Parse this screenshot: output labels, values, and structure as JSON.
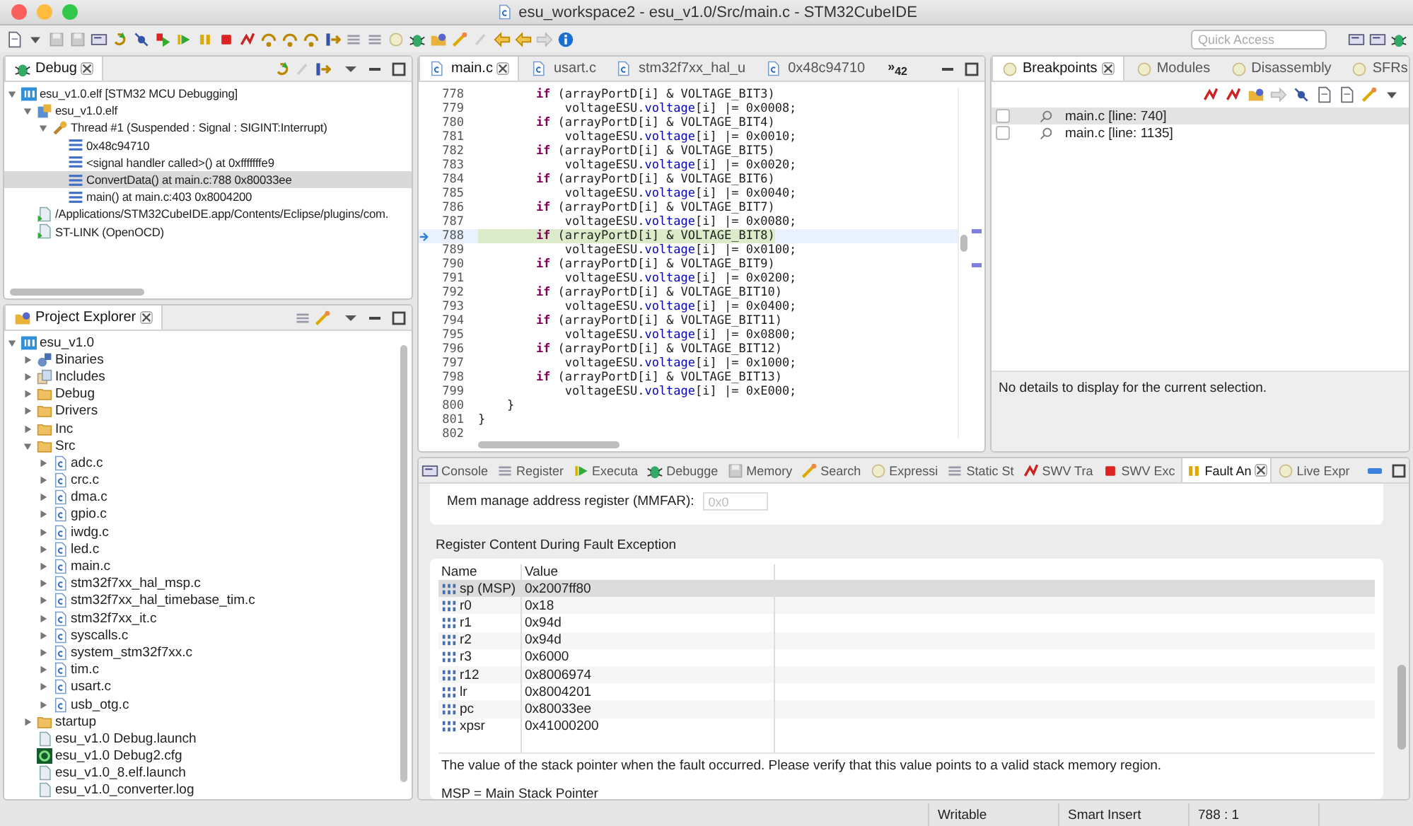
{
  "window": {
    "title": "esu_workspace2 - esu_v1.0/Src/main.c - STM32CubeIDE"
  },
  "toolbar": {
    "quick_access": {
      "placeholder": "Quick Access"
    }
  },
  "debug": {
    "tab": {
      "label": "Debug",
      "selected": true
    },
    "tree": [
      {
        "label": "esu_v1.0.elf [STM32 MCU Debugging]",
        "kind": "launch",
        "expanded": true,
        "selected": false,
        "children": [
          {
            "label": "esu_v1.0.elf",
            "kind": "process",
            "expanded": true,
            "selected": false,
            "children": [
              {
                "label": "Thread #1 (Suspended : Signal : SIGINT:Interrupt)",
                "kind": "thread",
                "expanded": true,
                "selected": false,
                "children": [
                  {
                    "label": "0x48c94710",
                    "kind": "frame",
                    "selected": false
                  },
                  {
                    "label": "<signal handler called>() at 0xfffffffe9",
                    "kind": "frame",
                    "selected": false
                  },
                  {
                    "label": "ConvertData() at main.c:788 0x80033ee",
                    "kind": "frame",
                    "selected": true
                  },
                  {
                    "label": "main() at main.c:403 0x8004200",
                    "kind": "frame",
                    "selected": false
                  }
                ]
              }
            ]
          },
          {
            "label": "/Applications/STM32CubeIDE.app/Contents/Eclipse/plugins/com.",
            "kind": "tool",
            "selected": false
          },
          {
            "label": "ST-LINK (OpenOCD)",
            "kind": "tool",
            "selected": false
          }
        ]
      }
    ]
  },
  "project_explorer": {
    "tab": {
      "label": "Project Explorer",
      "selected": true
    },
    "tree": [
      {
        "label": "esu_v1.0",
        "kind": "project",
        "expanded": true,
        "children": [
          {
            "label": "Binaries",
            "kind": "binaries",
            "expanded": false
          },
          {
            "label": "Includes",
            "kind": "includes",
            "expanded": false
          },
          {
            "label": "Debug",
            "kind": "folder",
            "expanded": false
          },
          {
            "label": "Drivers",
            "kind": "folder",
            "expanded": false
          },
          {
            "label": "Inc",
            "kind": "folder",
            "expanded": false
          },
          {
            "label": "Src",
            "kind": "folder",
            "expanded": true,
            "children": [
              {
                "label": "adc.c",
                "kind": "c-file",
                "expanded": false
              },
              {
                "label": "crc.c",
                "kind": "c-file",
                "expanded": false
              },
              {
                "label": "dma.c",
                "kind": "c-file",
                "expanded": false
              },
              {
                "label": "gpio.c",
                "kind": "c-file",
                "expanded": false
              },
              {
                "label": "iwdg.c",
                "kind": "c-file",
                "expanded": false
              },
              {
                "label": "led.c",
                "kind": "c-file",
                "expanded": false
              },
              {
                "label": "main.c",
                "kind": "c-file",
                "expanded": false
              },
              {
                "label": "stm32f7xx_hal_msp.c",
                "kind": "c-file",
                "expanded": false
              },
              {
                "label": "stm32f7xx_hal_timebase_tim.c",
                "kind": "c-file",
                "expanded": false
              },
              {
                "label": "stm32f7xx_it.c",
                "kind": "c-file",
                "expanded": false
              },
              {
                "label": "syscalls.c",
                "kind": "c-file",
                "expanded": false
              },
              {
                "label": "system_stm32f7xx.c",
                "kind": "c-file",
                "expanded": false
              },
              {
                "label": "tim.c",
                "kind": "c-file",
                "expanded": false
              },
              {
                "label": "usart.c",
                "kind": "c-file",
                "expanded": false
              },
              {
                "label": "usb_otg.c",
                "kind": "c-file",
                "expanded": false
              }
            ]
          },
          {
            "label": "startup",
            "kind": "folder",
            "expanded": false
          },
          {
            "label": "esu_v1.0 Debug.launch",
            "kind": "launch-file"
          },
          {
            "label": "esu_v1.0 Debug2.cfg",
            "kind": "cfg-file"
          },
          {
            "label": "esu_v1.0_8.elf.launch",
            "kind": "launch-file"
          },
          {
            "label": "esu_v1.0_converter.log",
            "kind": "launch-file"
          }
        ]
      }
    ]
  },
  "editor": {
    "tabs": [
      {
        "label": "main.c",
        "selected": true
      },
      {
        "label": "usart.c",
        "selected": false
      },
      {
        "label": "stm32f7xx_hal_u",
        "selected": false
      },
      {
        "label": "0x48c94710",
        "selected": false
      }
    ],
    "overflow": {
      "label": "»",
      "count": "42"
    },
    "lines": [
      {
        "number": "778",
        "current": false,
        "tokens": [
          {
            "kind": "keyword",
            "text": "        if"
          },
          {
            "kind": "plain",
            "text": " (arrayPortD[i] & VOLTAGE_BIT3)"
          }
        ]
      },
      {
        "number": "779",
        "current": false,
        "tokens": [
          {
            "kind": "plain",
            "text": "            voltageESU."
          },
          {
            "kind": "field",
            "text": "voltage"
          },
          {
            "kind": "plain",
            "text": "[i] |= 0x0008;"
          }
        ]
      },
      {
        "number": "780",
        "current": false,
        "tokens": [
          {
            "kind": "keyword",
            "text": "        if"
          },
          {
            "kind": "plain",
            "text": " (arrayPortD[i] & VOLTAGE_BIT4)"
          }
        ]
      },
      {
        "number": "781",
        "current": false,
        "tokens": [
          {
            "kind": "plain",
            "text": "            voltageESU."
          },
          {
            "kind": "field",
            "text": "voltage"
          },
          {
            "kind": "plain",
            "text": "[i] |= 0x0010;"
          }
        ]
      },
      {
        "number": "782",
        "current": false,
        "tokens": [
          {
            "kind": "keyword",
            "text": "        if"
          },
          {
            "kind": "plain",
            "text": " (arrayPortD[i] & VOLTAGE_BIT5)"
          }
        ]
      },
      {
        "number": "783",
        "current": false,
        "tokens": [
          {
            "kind": "plain",
            "text": "            voltageESU."
          },
          {
            "kind": "field",
            "text": "voltage"
          },
          {
            "kind": "plain",
            "text": "[i] |= 0x0020;"
          }
        ]
      },
      {
        "number": "784",
        "current": false,
        "tokens": [
          {
            "kind": "keyword",
            "text": "        if"
          },
          {
            "kind": "plain",
            "text": " (arrayPortD[i] & VOLTAGE_BIT6)"
          }
        ]
      },
      {
        "number": "785",
        "current": false,
        "tokens": [
          {
            "kind": "plain",
            "text": "            voltageESU."
          },
          {
            "kind": "field",
            "text": "voltage"
          },
          {
            "kind": "plain",
            "text": "[i] |= 0x0040;"
          }
        ]
      },
      {
        "number": "786",
        "current": false,
        "tokens": [
          {
            "kind": "keyword",
            "text": "        if"
          },
          {
            "kind": "plain",
            "text": " (arrayPortD[i] & VOLTAGE_BIT7)"
          }
        ]
      },
      {
        "number": "787",
        "current": false,
        "tokens": [
          {
            "kind": "plain",
            "text": "            voltageESU."
          },
          {
            "kind": "field",
            "text": "voltage"
          },
          {
            "kind": "plain",
            "text": "[i] |= 0x0080;"
          }
        ]
      },
      {
        "number": "788",
        "current": true,
        "tokens": [
          {
            "kind": "keyword",
            "text": "        if"
          },
          {
            "kind": "plain",
            "text": " (arrayPortD[i] & VOLTAGE_BIT8)"
          }
        ]
      },
      {
        "number": "789",
        "current": false,
        "tokens": [
          {
            "kind": "plain",
            "text": "            voltageESU."
          },
          {
            "kind": "field",
            "text": "voltage"
          },
          {
            "kind": "plain",
            "text": "[i] |= 0x0100;"
          }
        ]
      },
      {
        "number": "790",
        "current": false,
        "tokens": [
          {
            "kind": "keyword",
            "text": "        if"
          },
          {
            "kind": "plain",
            "text": " (arrayPortD[i] & VOLTAGE_BIT9)"
          }
        ]
      },
      {
        "number": "791",
        "current": false,
        "tokens": [
          {
            "kind": "plain",
            "text": "            voltageESU."
          },
          {
            "kind": "field",
            "text": "voltage"
          },
          {
            "kind": "plain",
            "text": "[i] |= 0x0200;"
          }
        ]
      },
      {
        "number": "792",
        "current": false,
        "tokens": [
          {
            "kind": "keyword",
            "text": "        if"
          },
          {
            "kind": "plain",
            "text": " (arrayPortD[i] & VOLTAGE_BIT10)"
          }
        ]
      },
      {
        "number": "793",
        "current": false,
        "tokens": [
          {
            "kind": "plain",
            "text": "            voltageESU."
          },
          {
            "kind": "field",
            "text": "voltage"
          },
          {
            "kind": "plain",
            "text": "[i] |= 0x0400;"
          }
        ]
      },
      {
        "number": "794",
        "current": false,
        "tokens": [
          {
            "kind": "keyword",
            "text": "        if"
          },
          {
            "kind": "plain",
            "text": " (arrayPortD[i] & VOLTAGE_BIT11)"
          }
        ]
      },
      {
        "number": "795",
        "current": false,
        "tokens": [
          {
            "kind": "plain",
            "text": "            voltageESU."
          },
          {
            "kind": "field",
            "text": "voltage"
          },
          {
            "kind": "plain",
            "text": "[i] |= 0x0800;"
          }
        ]
      },
      {
        "number": "796",
        "current": false,
        "tokens": [
          {
            "kind": "keyword",
            "text": "        if"
          },
          {
            "kind": "plain",
            "text": " (arrayPortD[i] & VOLTAGE_BIT12)"
          }
        ]
      },
      {
        "number": "797",
        "current": false,
        "tokens": [
          {
            "kind": "plain",
            "text": "            voltageESU."
          },
          {
            "kind": "field",
            "text": "voltage"
          },
          {
            "kind": "plain",
            "text": "[i] |= 0x1000;"
          }
        ]
      },
      {
        "number": "798",
        "current": false,
        "tokens": [
          {
            "kind": "keyword",
            "text": "        if"
          },
          {
            "kind": "plain",
            "text": " (arrayPortD[i] & VOLTAGE_BIT13)"
          }
        ]
      },
      {
        "number": "799",
        "current": false,
        "tokens": [
          {
            "kind": "plain",
            "text": "            voltageESU."
          },
          {
            "kind": "field",
            "text": "voltage"
          },
          {
            "kind": "plain",
            "text": "[i] |= 0xE000;"
          }
        ]
      },
      {
        "number": "800",
        "current": false,
        "tokens": [
          {
            "kind": "plain",
            "text": "    }"
          }
        ]
      },
      {
        "number": "801",
        "current": false,
        "tokens": [
          {
            "kind": "plain",
            "text": "}"
          }
        ]
      },
      {
        "number": "802",
        "current": false
      }
    ]
  },
  "breakpoints": {
    "tabs": [
      {
        "label": "Breakpoints",
        "selected": true
      },
      {
        "label": "Modules",
        "selected": false
      },
      {
        "label": "Disassembly",
        "selected": false
      },
      {
        "label": "SFRs",
        "selected": false
      }
    ],
    "items": [
      {
        "label": "main.c [line: 740]",
        "checked": false,
        "selected": true
      },
      {
        "label": "main.c [line: 1135]",
        "checked": false,
        "selected": false
      }
    ],
    "details": "No details to display for the current selection."
  },
  "bottom_panel": {
    "tabs": [
      {
        "label": "Console",
        "selected": false
      },
      {
        "label": "Register",
        "selected": false
      },
      {
        "label": "Executa",
        "selected": false
      },
      {
        "label": "Debugge",
        "selected": false
      },
      {
        "label": "Memory",
        "selected": false
      },
      {
        "label": "Search",
        "selected": false
      },
      {
        "label": "Expressi",
        "selected": false
      },
      {
        "label": "Static St",
        "selected": false
      },
      {
        "label": "SWV Tra",
        "selected": false
      },
      {
        "label": "SWV Exc",
        "selected": false
      },
      {
        "label": "Fault An",
        "selected": true
      },
      {
        "label": "Live Expr",
        "selected": false
      }
    ],
    "mmfar": {
      "label": "Mem manage address register (MMFAR):",
      "value": "0x0",
      "disabled": true
    },
    "section_title": "Register Content During Fault Exception",
    "table": {
      "columns": [
        "Name",
        "Value"
      ],
      "rows": [
        {
          "name": "sp (MSP)",
          "value": "0x2007ff80",
          "selected": true
        },
        {
          "name": "r0",
          "value": "0x18",
          "selected": false
        },
        {
          "name": "r1",
          "value": "0x94d",
          "selected": false
        },
        {
          "name": "r2",
          "value": "0x94d",
          "selected": false
        },
        {
          "name": "r3",
          "value": "0x6000",
          "selected": false
        },
        {
          "name": "r12",
          "value": "0x8006974",
          "selected": false
        },
        {
          "name": "lr",
          "value": "0x8004201",
          "selected": false
        },
        {
          "name": "pc",
          "value": "0x80033ee",
          "selected": false
        },
        {
          "name": "xpsr",
          "value": "0x41000200",
          "selected": false
        }
      ]
    },
    "description": [
      "The value of the stack pointer when the fault occurred. Please verify that this value points to a valid stack memory region.",
      "MSP = Main Stack Pointer"
    ]
  },
  "status_bar": {
    "fields": [
      "Writable",
      "Smart Insert",
      "788 : 1"
    ]
  }
}
